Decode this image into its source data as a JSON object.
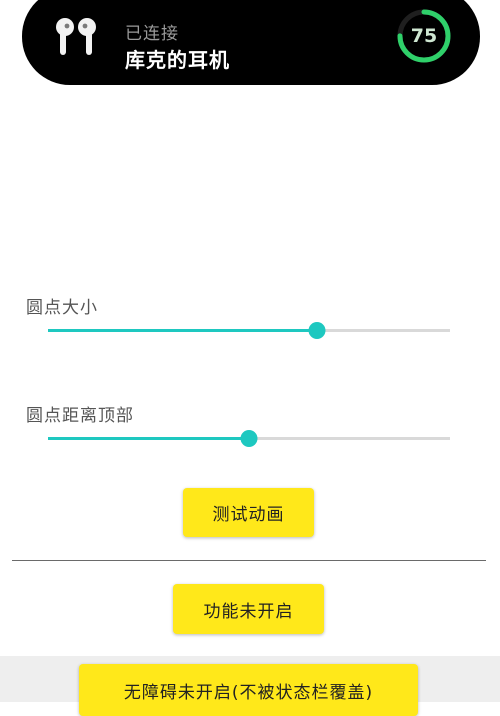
{
  "island": {
    "status": "已连接",
    "device_name": "库克的耳机",
    "battery": "75",
    "battery_fraction": 0.75
  },
  "dot_size": {
    "label": "圆点大小",
    "value_fraction": 0.67
  },
  "dot_top_distance": {
    "label": "圆点距离顶部",
    "value_fraction": 0.5
  },
  "buttons": {
    "test_animation": "测试动画",
    "feature_status": "功能未开启",
    "accessibility_status": "无障碍未开启(不被状态栏覆盖)"
  },
  "colors": {
    "accent": "#1ec8c0",
    "button": "#ffe81a",
    "battery_ring": "#2fd06a",
    "island": "#000000"
  }
}
